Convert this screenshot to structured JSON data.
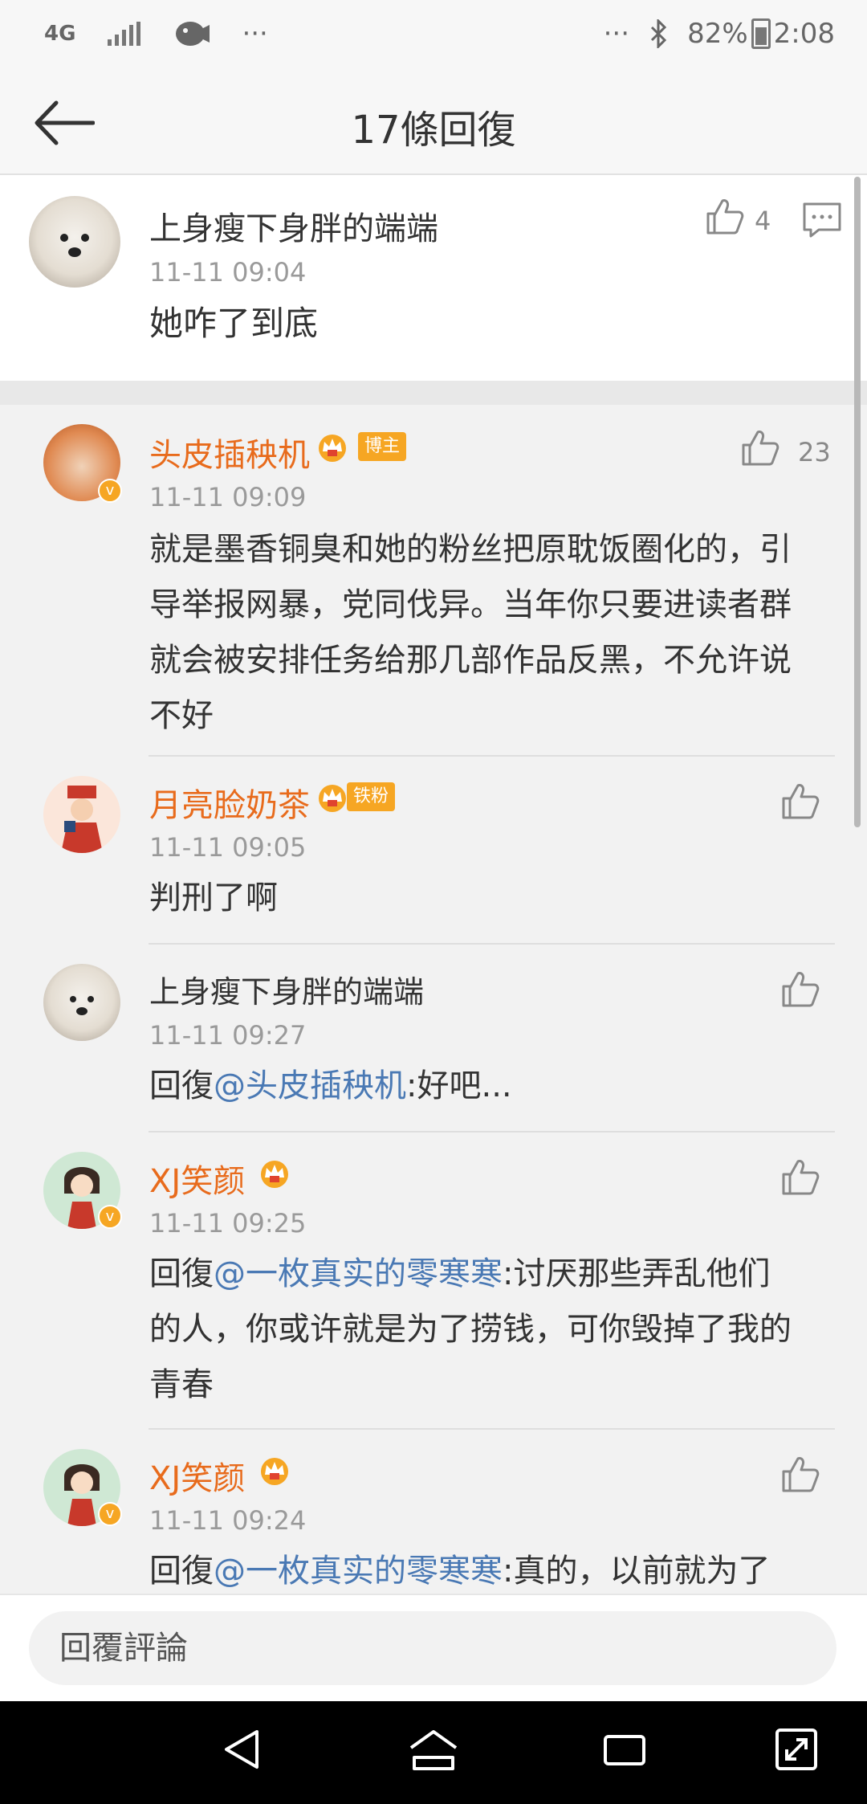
{
  "status": {
    "network": "4G",
    "more": "···",
    "more_right": "···",
    "battery": "82%",
    "time": "2:08"
  },
  "header": {
    "title": "17條回復"
  },
  "main_comment": {
    "name": "上身瘦下身胖的端端",
    "time": "11-11 09:04",
    "text": "她咋了到底",
    "likes": "4"
  },
  "replies": [
    {
      "name": "头皮插秧机",
      "badge": "博主",
      "time": "11-11 09:09",
      "text_lines": [
        "就是墨香铜臭和她的粉丝把原耽饭圈化的，引",
        "导举报网暴，党同伐异。当年你只要进读者群",
        "就会被安排任务给那几部作品反黑，不允许说",
        "不好"
      ],
      "likes": "23"
    },
    {
      "name": "月亮脸奶茶",
      "badge": "铁粉",
      "time": "11-11 09:05",
      "text": "判刑了啊"
    },
    {
      "name": "上身瘦下身胖的端端",
      "time": "11-11 09:27",
      "prefix": "回復",
      "mention": "@头皮插秧机",
      "rest": ":好吧..."
    },
    {
      "name": "XJ笑颜",
      "time": "11-11 09:25",
      "prefix": "回復",
      "mention": "@一枚真实的零寒寒",
      "rest": ":讨厌那些弄乱他们",
      "lines2": [
        "的人，你或许就是为了捞钱，可你毁掉了我的",
        "青春"
      ]
    },
    {
      "name": "XJ笑颜",
      "time": "11-11 09:24",
      "prefix": "回復",
      "mention": "@一枚真实的零寒寒",
      "rest": ":真的，以前就为了"
    }
  ],
  "footer": {
    "placeholder": "回覆評論"
  },
  "colors": {
    "orange": "#e86b1c",
    "link": "#4a79b4",
    "badge": "#f6a623"
  }
}
